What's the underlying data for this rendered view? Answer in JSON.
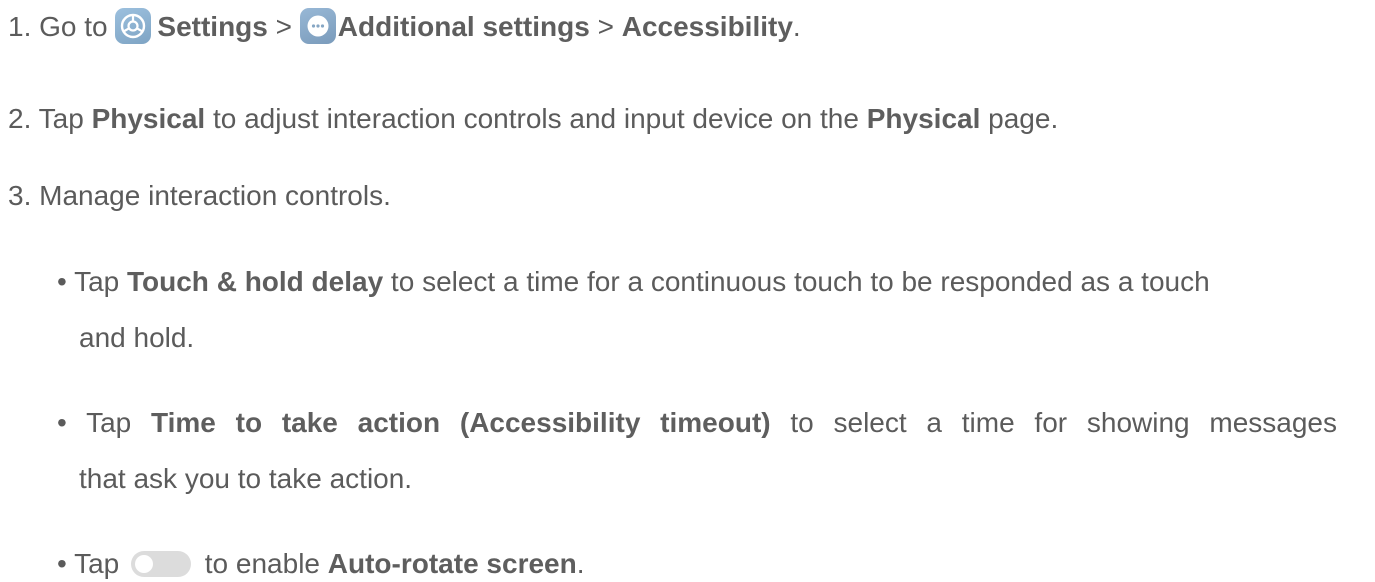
{
  "step1": {
    "prefix": "1. Go to ",
    "settings": "Settings",
    "sep1": " > ",
    "additional": "Additional settings",
    "sep2": " > ",
    "accessibility": "Accessibility",
    "end": ".",
    "settings_icon": "settings-gear-icon",
    "more_icon": "more-dots-icon"
  },
  "step2": {
    "prefix": "2. Tap ",
    "physical1": "Physical",
    "middle": " to adjust interaction controls and input device on the ",
    "physical2": "Physical",
    "end": " page."
  },
  "step3": {
    "text": "3. Manage interaction controls."
  },
  "bullet1": {
    "prefix": "• Tap ",
    "bold": "Touch & hold delay",
    "rest": " to select a time for a continuous touch to be responded as a touch",
    "cont": "and hold."
  },
  "bullet2": {
    "prefix": "• Tap ",
    "bold": "Time to take action (Accessibility timeout)",
    "rest": " to select a time for showing messages",
    "cont": "that ask you to take action."
  },
  "bullet3": {
    "prefix": "• Tap ",
    "middle": " to enable ",
    "bold": "Auto-rotate screen",
    "end": ".",
    "toggle_icon": "toggle-switch-icon"
  }
}
